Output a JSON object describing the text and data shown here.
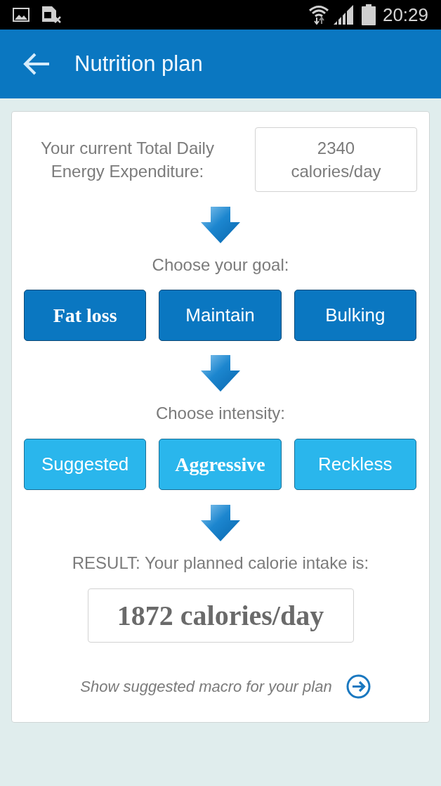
{
  "status_bar": {
    "time": "20:29"
  },
  "app_bar": {
    "title": "Nutrition plan"
  },
  "tdee": {
    "label": "Your current Total Daily Energy Expenditure:",
    "value": "2340",
    "unit": "calories/day"
  },
  "goal": {
    "prompt": "Choose your goal:",
    "options": [
      {
        "label": "Fat loss",
        "selected": true
      },
      {
        "label": "Maintain",
        "selected": false
      },
      {
        "label": "Bulking",
        "selected": false
      }
    ]
  },
  "intensity": {
    "prompt": "Choose intensity:",
    "options": [
      {
        "label": "Suggested",
        "selected": false
      },
      {
        "label": "Aggressive",
        "selected": true
      },
      {
        "label": "Reckless",
        "selected": false
      }
    ]
  },
  "result": {
    "label": "RESULT: Your planned calorie intake is:",
    "value": "1872 calories/day"
  },
  "macro_link": {
    "label": "Show suggested macro for your plan"
  }
}
